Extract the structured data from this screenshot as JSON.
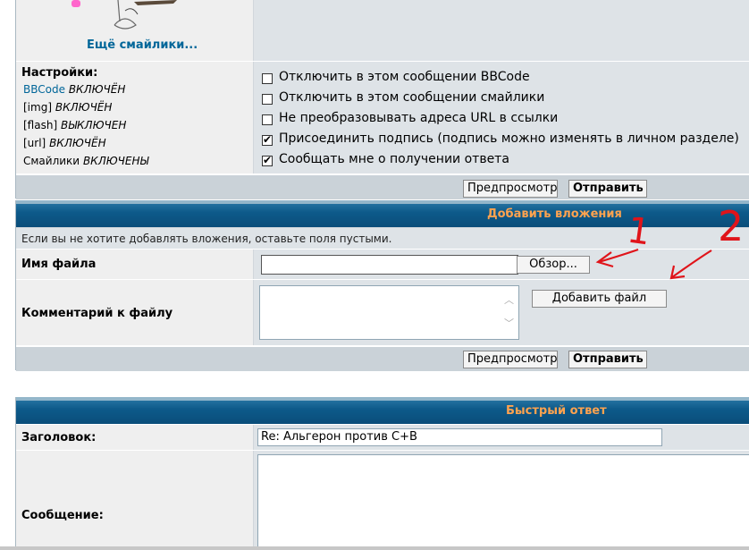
{
  "smilies": {
    "more_link": "Ещё смайлики..."
  },
  "settings": {
    "title": "Настройки:",
    "lines": [
      {
        "name": "BBCode",
        "state": "ВКЛЮЧЁН",
        "link": true
      },
      {
        "name": "[img]",
        "state": "ВКЛЮЧЁН",
        "link": false
      },
      {
        "name": "[flash]",
        "state": "ВЫКЛЮЧЕН",
        "link": false
      },
      {
        "name": "[url]",
        "state": "ВКЛЮЧЁН",
        "link": false
      },
      {
        "name": "Смайлики",
        "state": "ВКЛЮЧЕНЫ",
        "link": false
      }
    ]
  },
  "options": [
    {
      "label": "Отключить в этом сообщении BBCode",
      "checked": false
    },
    {
      "label": "Отключить в этом сообщении смайлики",
      "checked": false
    },
    {
      "label": "Не преобразовывать адреса URL в ссылки",
      "checked": false
    },
    {
      "label": "Присоединить подпись (подпись можно изменять в личном разделе)",
      "checked": true
    },
    {
      "label": "Сообщать мне о получении ответа",
      "checked": true
    }
  ],
  "buttons": {
    "preview": "Предпросмотр",
    "submit": "Отправить",
    "browse": "Обзор...",
    "add_file": "Добавить файл"
  },
  "attachments": {
    "header": "Добавить вложения",
    "hint": "Если вы не хотите добавлять вложения, оставьте поля пустыми.",
    "filename_label": "Имя файла",
    "filename_value": "",
    "comment_label": "Комментарий к файлу",
    "comment_value": ""
  },
  "annotations": {
    "num1": "1",
    "num2": "2"
  },
  "quick_reply": {
    "header": "Быстрый ответ",
    "subject_label": "Заголовок:",
    "subject_value": "Re: Альгерон против C+B",
    "message_label": "Сообщение:",
    "message_value": ""
  },
  "colors": {
    "header_text": "#ffa34f",
    "link": "#006699",
    "annotation": "#e0141a"
  }
}
